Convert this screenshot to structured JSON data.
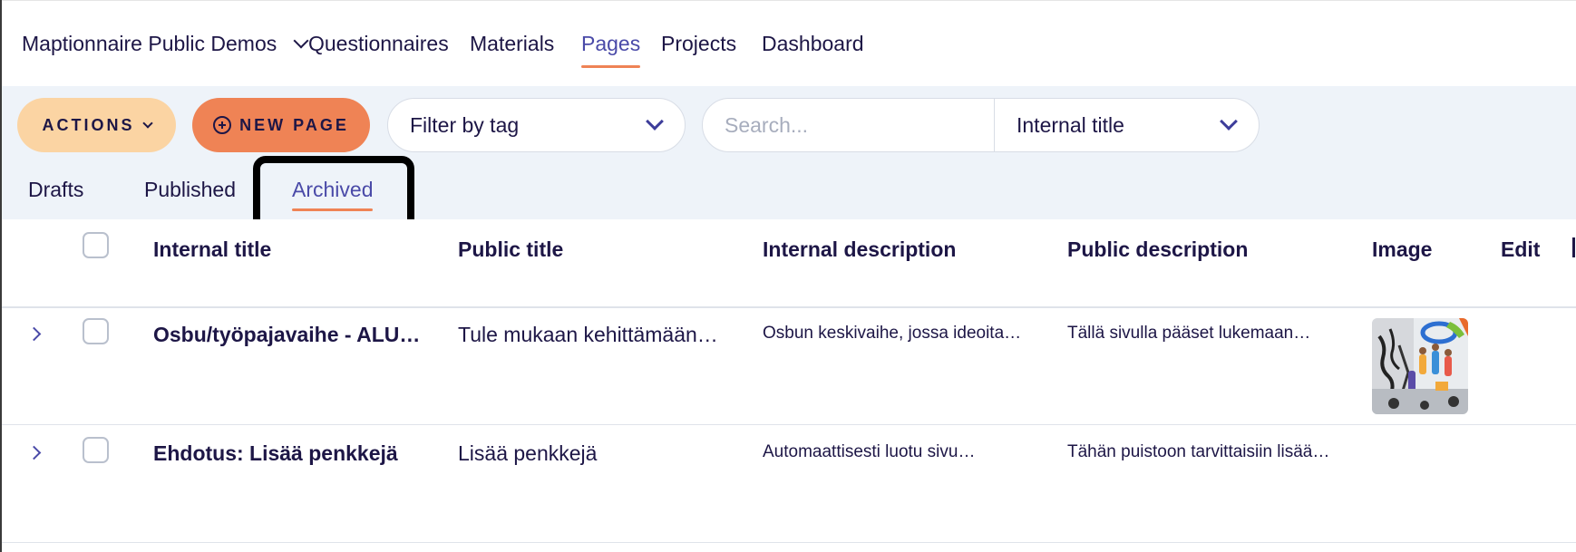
{
  "nav": {
    "org": "Maptionnaire Public Demos",
    "items": [
      "Questionnaires",
      "Materials",
      "Pages",
      "Projects",
      "Dashboard"
    ],
    "active": "Pages"
  },
  "toolbar": {
    "actions_label": "ACTIONS",
    "new_page_label": "NEW PAGE",
    "filter_tag_label": "Filter by tag",
    "search_placeholder": "Search...",
    "search_field": "Internal title"
  },
  "tabs": {
    "items": [
      "Drafts",
      "Published",
      "Archived"
    ],
    "active": "Archived"
  },
  "table": {
    "columns": [
      "Internal title",
      "Public title",
      "Internal description",
      "Public description",
      "Image",
      "Edit"
    ],
    "rows": [
      {
        "internal_title": "Osbu/työpajavaihe - ALU…",
        "public_title": "Tule mukaan kehittämään…",
        "internal_description": "Osbun keskivaihe, jossa ideoita…",
        "public_description": "Tällä sivulla pääset lukemaan…",
        "has_image": true
      },
      {
        "internal_title": "Ehdotus: Lisää penkkejä",
        "public_title": "Lisää penkkejä",
        "internal_description": "Automaattisesti luotu sivu…",
        "public_description": "Tähän puistoon tarvittaisiin lisää…",
        "has_image": false
      }
    ]
  },
  "colors": {
    "accent_orange": "#ef8355",
    "actions_peach": "#fbd4a3",
    "active_blue": "#4a4aa8",
    "text_navy": "#1d1646",
    "band_bg": "#eef3f9"
  }
}
